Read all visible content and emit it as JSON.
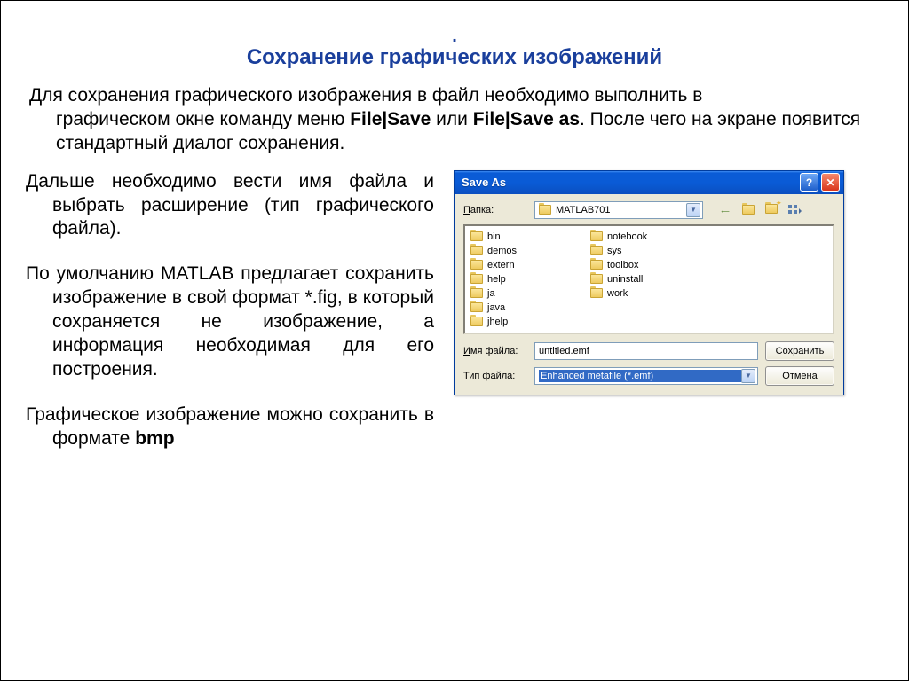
{
  "title": "Сохранение графических изображений",
  "intro_line1": "Для сохранения графического изображения в файл необходимо выполнить в",
  "intro_line2_a": "графическом окне команду меню ",
  "intro_bold1": "File|Save",
  "intro_line2_b": " или ",
  "intro_bold2": "File|Save as",
  "intro_line2_c": ". После чего на экране появится стандартный диалог сохранения.",
  "left_p1": "Дальше необходимо вести имя файла и выбрать расширение (тип графического файла).",
  "left_p2": "По умолчанию MATLAB предлагает сохранить изображение в свой формат *.fig, в который сохраняется не изображение, а информация необходимая для его построения.",
  "left_p3_a": "Графическое изображение можно сохранить в формате ",
  "left_p3_bold": "bmp",
  "dialog": {
    "title": "Save As",
    "folder_label": "Папка:",
    "folder_value": "MATLAB701",
    "folders_col1": [
      "bin",
      "demos",
      "extern",
      "help",
      "ja",
      "java"
    ],
    "folders_col2": [
      "jhelp",
      "notebook",
      "sys",
      "toolbox",
      "uninstall",
      "work"
    ],
    "filename_label": "Имя файла:",
    "filename_value": "untitled.emf",
    "filetype_label": "Тип файла:",
    "filetype_value": "Enhanced metafile (*.emf)",
    "save_button": "Сохранить",
    "cancel_button": "Отмена"
  }
}
